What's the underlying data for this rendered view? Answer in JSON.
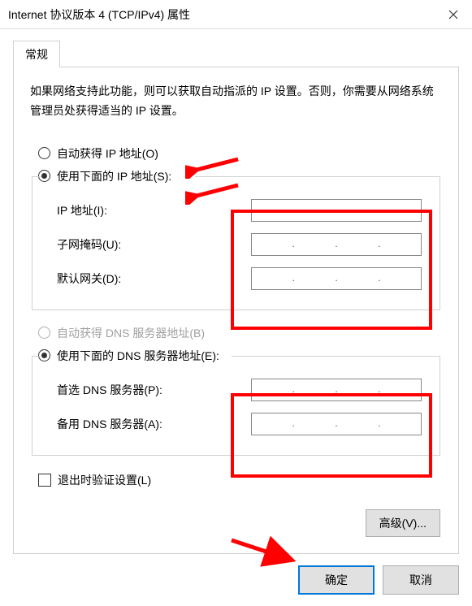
{
  "window": {
    "title": "Internet 协议版本 4 (TCP/IPv4) 属性"
  },
  "tab": {
    "general": "常规"
  },
  "intro": "如果网络支持此功能，则可以获取自动指派的 IP 设置。否则，你需要从网络系统管理员处获得适当的 IP 设置。",
  "ip": {
    "radio_auto": "自动获得 IP 地址(O)",
    "radio_manual": "使用下面的 IP 地址(S):",
    "label_address": "IP 地址(I):",
    "label_mask": "子网掩码(U):",
    "label_gateway": "默认网关(D):",
    "value_address": [
      "",
      "",
      "",
      ""
    ],
    "value_mask": [
      "",
      "",
      "",
      ""
    ],
    "value_gateway": [
      "",
      "",
      "",
      ""
    ]
  },
  "dns": {
    "radio_auto": "自动获得 DNS 服务器地址(B)",
    "radio_manual": "使用下面的 DNS 服务器地址(E):",
    "label_preferred": "首选 DNS 服务器(P):",
    "label_alternate": "备用 DNS 服务器(A):",
    "value_preferred": [
      "",
      "",
      "",
      ""
    ],
    "value_alternate": [
      "",
      "",
      "",
      ""
    ]
  },
  "validate_checkbox": "退出时验证设置(L)",
  "advanced_button": "高级(V)...",
  "buttons": {
    "ok": "确定",
    "cancel": "取消"
  }
}
